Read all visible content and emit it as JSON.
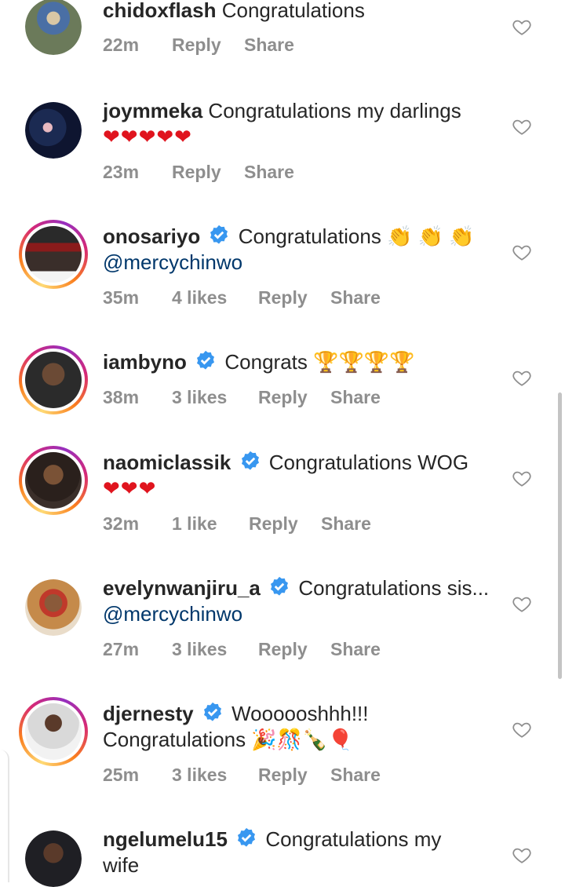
{
  "labels": {
    "reply": "Reply",
    "share": "Share"
  },
  "comments": [
    {
      "username": "chidoxflash",
      "verified": false,
      "text": "Congratulations",
      "time": "22m",
      "likes": ""
    },
    {
      "username": "joymmeka",
      "verified": false,
      "text": "Congratulations my darlings",
      "extra": "❤❤❤❤❤",
      "time": "23m",
      "likes": ""
    },
    {
      "username": "onosariyo",
      "verified": true,
      "text": "Congratulations 👏 👏 👏",
      "mention": "@mercychinwo",
      "time": "35m",
      "likes": "4 likes"
    },
    {
      "username": "iambyno",
      "verified": true,
      "text": "Congrats 🏆🏆🏆🏆",
      "time": "38m",
      "likes": "3 likes"
    },
    {
      "username": "naomiclassik",
      "verified": true,
      "text": "Congratulations WOG",
      "extra": "❤❤❤",
      "time": "32m",
      "likes": "1 like"
    },
    {
      "username": "evelynwanjiru_a",
      "verified": true,
      "text": "Congratulations sis...",
      "mention": "@mercychinwo",
      "time": "27m",
      "likes": "3 likes"
    },
    {
      "username": "djernesty",
      "verified": true,
      "text": "Woooooshhh!!!",
      "text2": "Congratulations 🎉🎊🍾🎈",
      "time": "25m",
      "likes": "3 likes"
    },
    {
      "username": "ngelumelu15",
      "verified": true,
      "text": "Congratulations my",
      "text2": "wife"
    }
  ],
  "avatar_colors": {
    "c0": "#6b7a5a",
    "c1": "#1b2a52",
    "c2": "#3a2e2a",
    "c3": "#2b2b2b",
    "c4": "#3b2f2a",
    "c5": "#c58a4a",
    "c6": "#d9d9d9",
    "c7": "#1f1f24"
  }
}
